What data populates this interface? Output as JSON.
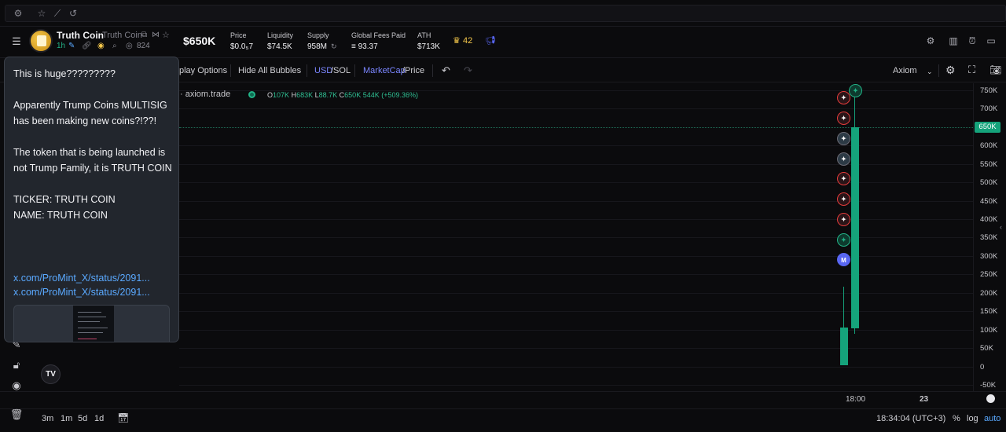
{
  "token": {
    "name": "Truth Coin",
    "subname": "Truth Coin",
    "age": "1h",
    "holders": "824",
    "market_cap": "$650K"
  },
  "stats": [
    {
      "label": "Price",
      "value": "$0.0₅7"
    },
    {
      "label": "Liquidity",
      "value": "$74.5K"
    },
    {
      "label": "Supply",
      "value": "958M"
    },
    {
      "label": "Global Fees Paid",
      "value": "≡ 93.37"
    },
    {
      "label": "ATH",
      "value": "$713K"
    }
  ],
  "crown_count": "42",
  "toolbar": {
    "display_options": "play Options",
    "hide_bubbles": "Hide All Bubbles",
    "usd": "USD",
    "sol": "/SOL",
    "marketcap": "MarketCap",
    "price": "/Price",
    "source": "Axiom"
  },
  "legend": {
    "title": "· axiom.trade",
    "open": "107K",
    "high": "683K",
    "low": "88.7K",
    "close": "650K 544K (+509.36%)",
    "o_label": "O",
    "h_label": "H",
    "l_label": "L",
    "c_label": "C"
  },
  "price_axis": [
    "750K",
    "700K",
    "650K",
    "600K",
    "550K",
    "500K",
    "450K",
    "400K",
    "350K",
    "300K",
    "250K",
    "200K",
    "150K",
    "100K",
    "50K",
    "0",
    "-50K"
  ],
  "current_price_tag": "650K",
  "time_axis": [
    "18:00",
    "23"
  ],
  "bottom_bar": {
    "ranges": [
      "3m",
      "1m",
      "5d",
      "1d"
    ],
    "clock": "18:34:04 (UTC+3)",
    "pct": "%",
    "log": "log",
    "auto": "auto"
  },
  "popup": {
    "message": "This is huge?????????\n\nApparently Trump Coins MULTISIG has been making new coins?!??!\n\nThe token that is being launched is not Trump Family, it is TRUTH COIN\n\nTICKER: TRUTH COIN\nNAME: TRUTH COIN",
    "link1": "x.com/ProMint_X/status/2091...",
    "link2": "x.com/ProMint_X/status/2091..."
  },
  "tv_logo": "TV",
  "bubble_m": "M",
  "accent_green": "#15a37b",
  "link_blue": "#5aa9ff"
}
